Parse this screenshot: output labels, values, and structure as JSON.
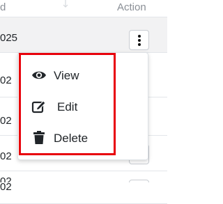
{
  "table": {
    "columns": {
      "left_fragment": "d",
      "action": "Action"
    },
    "rows": [
      {
        "date_fragment": "025"
      },
      {
        "date_fragment": "02"
      },
      {
        "date_fragment": "02"
      },
      {
        "date_fragment": "02"
      },
      {
        "date_fragment": "02"
      },
      {
        "date_fragment": "02"
      }
    ]
  },
  "action_menu": {
    "items": [
      {
        "label": "View",
        "icon": "eye-icon"
      },
      {
        "label": "Edit",
        "icon": "edit-icon"
      },
      {
        "label": "Delete",
        "icon": "trash-icon"
      }
    ]
  },
  "colors": {
    "highlight_border": "#e8000b",
    "header_text": "#8a8f96",
    "row_hover_bg": "#f2f2f3"
  }
}
